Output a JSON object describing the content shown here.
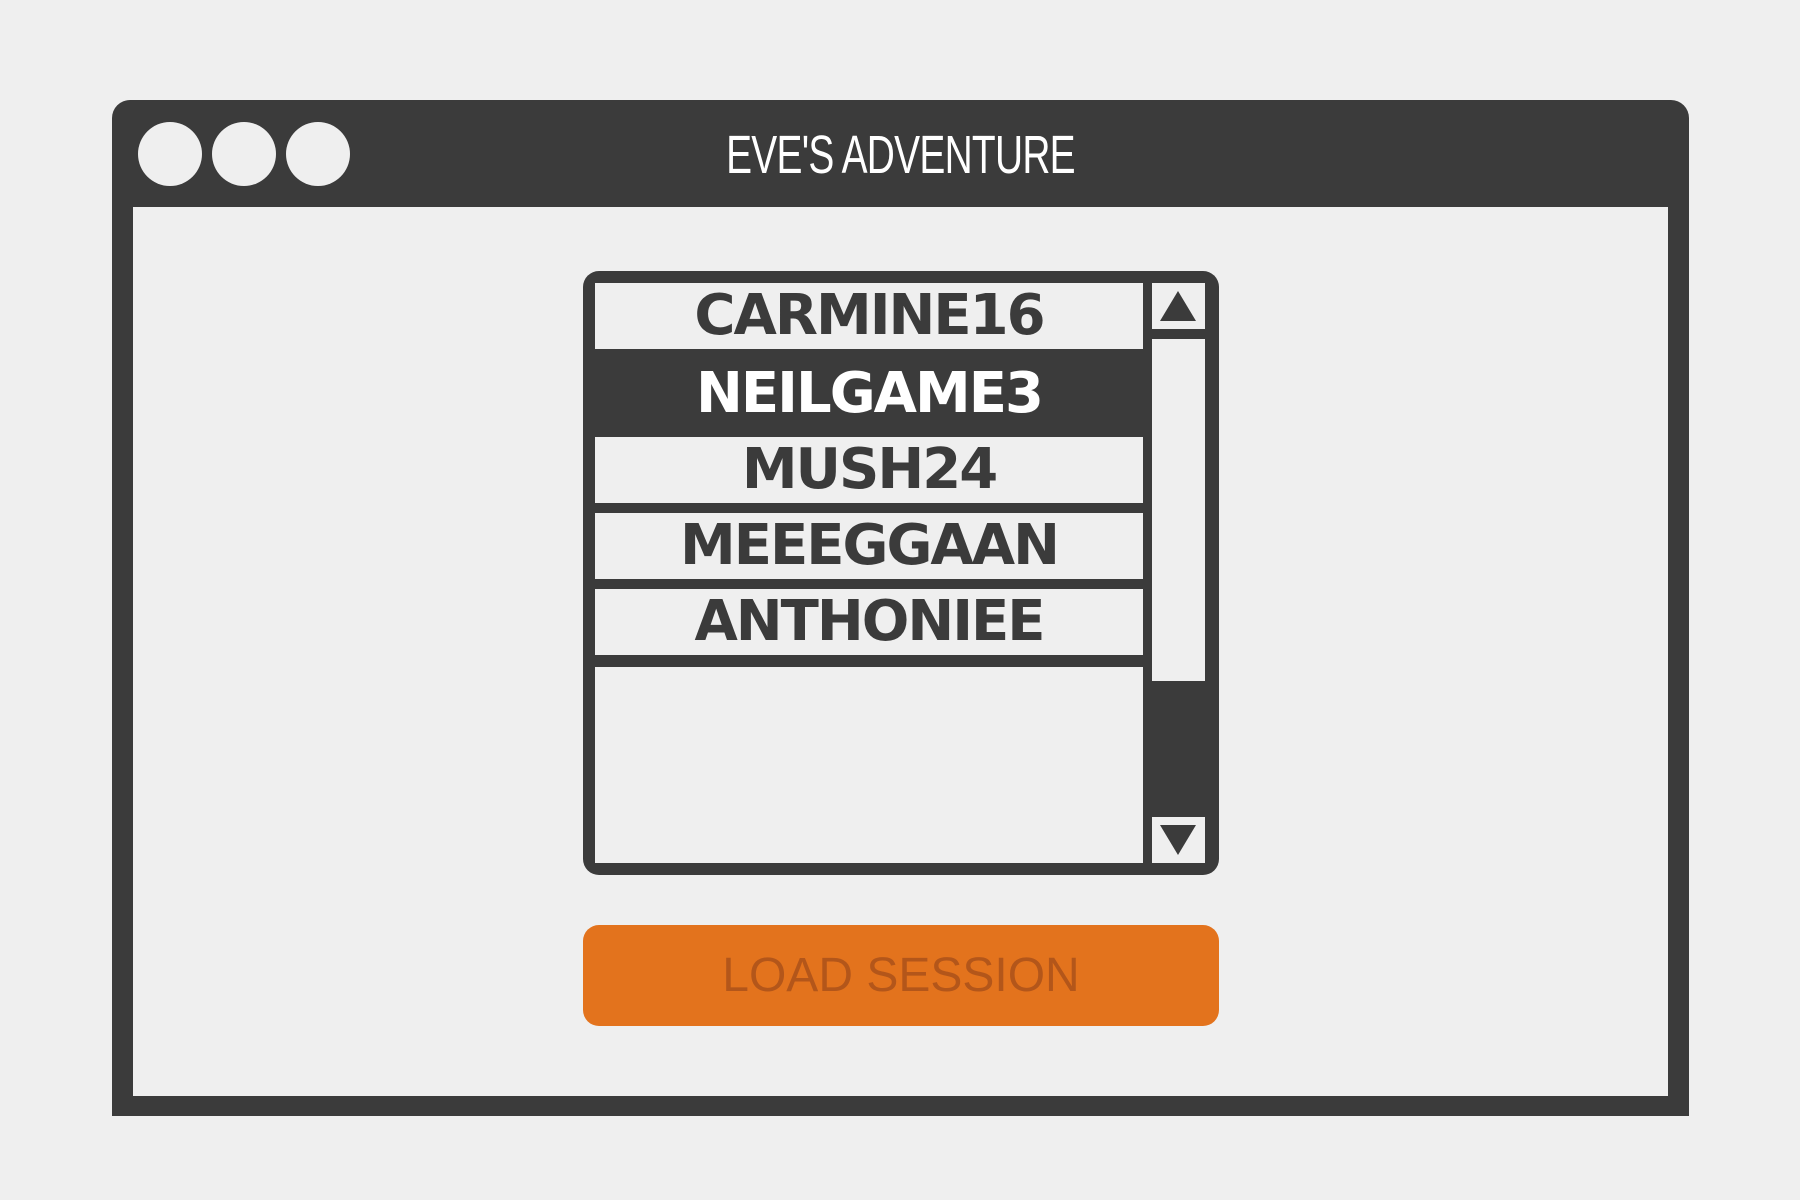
{
  "window": {
    "title": "EVE'S ADVENTURE",
    "controls": [
      "window-dot-icon",
      "window-dot-icon",
      "window-dot-icon"
    ]
  },
  "session_list": {
    "items": [
      {
        "label": "CARMINE16",
        "selected": false
      },
      {
        "label": "NEILGAME3",
        "selected": true
      },
      {
        "label": "MUSH24",
        "selected": false
      },
      {
        "label": "MEEEGGAAN",
        "selected": false
      },
      {
        "label": "ANTHONIEE",
        "selected": false
      }
    ],
    "scroll_up_icon": "triangle-up-icon",
    "scroll_down_icon": "triangle-down-icon"
  },
  "load_button": {
    "label": "LOAD SESSION"
  },
  "colors": {
    "background": "#efefef",
    "frame": "#3b3b3b",
    "accent": "#e3731d",
    "accent_text": "#b3561a"
  }
}
